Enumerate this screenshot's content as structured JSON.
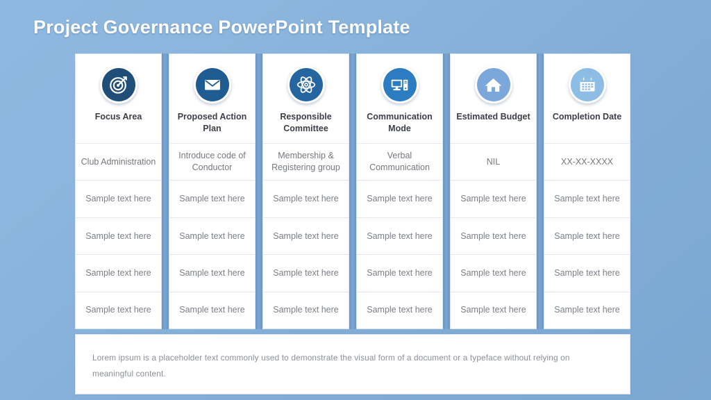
{
  "slide": {
    "title": "Project Governance PowerPoint Template",
    "title_color": "#ffffff",
    "background_from": "#8fb8e0",
    "background_to": "#7ba8d2",
    "separator_color": "#6b97c6"
  },
  "columns": [
    {
      "icon": "target-icon",
      "icon_bg": "#1f4e79",
      "label": "Focus Area",
      "cells": [
        "Club Administration",
        "Sample text here",
        "Sample text here",
        "Sample text here",
        "Sample text here"
      ]
    },
    {
      "icon": "envelope-icon",
      "icon_bg": "#1f5c91",
      "label": "Proposed Action Plan",
      "cells": [
        "Introduce code of Conductor",
        "Sample text here",
        "Sample text here",
        "Sample text here",
        "Sample text here"
      ]
    },
    {
      "icon": "atom-icon",
      "icon_bg": "#2566a0",
      "label": "Responsible Committee",
      "cells": [
        "Membership & Registering group",
        "Sample text here",
        "Sample text here",
        "Sample text here",
        "Sample text here"
      ]
    },
    {
      "icon": "desktop-computer-icon",
      "icon_bg": "#2b7cc0",
      "label": "Communication Mode",
      "cells": [
        "Verbal Communication",
        "Sample text here",
        "Sample text here",
        "Sample text here",
        "Sample text here"
      ]
    },
    {
      "icon": "home-icon",
      "icon_bg": "#7ba7da",
      "label": "Estimated Budget",
      "cells": [
        "NIL",
        "Sample text here",
        "Sample text here",
        "Sample text here",
        "Sample text here"
      ]
    },
    {
      "icon": "calendar-icon",
      "icon_bg": "#8dbde4",
      "label": "Completion Date",
      "cells": [
        "XX-XX-XXXX",
        "Sample text here",
        "Sample text here",
        "Sample text here",
        "Sample text here"
      ]
    }
  ],
  "footer": {
    "text": "Lorem ipsum is a placeholder text commonly used to demonstrate the visual form of a document or a typeface without relying on meaningful content."
  }
}
